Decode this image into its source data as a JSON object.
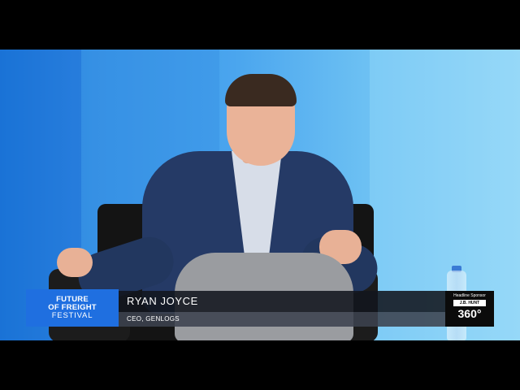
{
  "lower_third": {
    "logo": {
      "line1": "FUTURE",
      "line2": "OF FREIGHT",
      "line3": "FESTIVAL"
    },
    "speaker_name": "RYAN JOYCE",
    "speaker_title": "CEO, GENLOGS",
    "sponsor": {
      "label": "Headline Sponsor",
      "brand": "J.B. HUNT",
      "product": "360°"
    }
  },
  "colors": {
    "brand_blue": "#1f6fe0",
    "backdrop_blue": "#4aa5ee",
    "name_bar": "#12161e"
  }
}
